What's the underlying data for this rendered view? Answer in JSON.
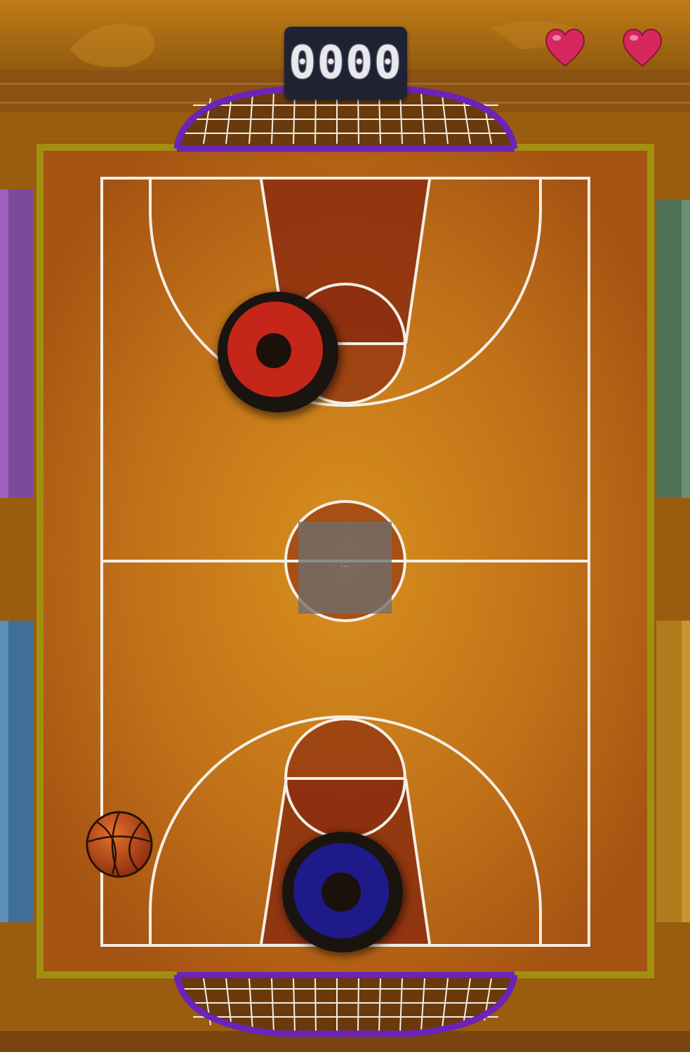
{
  "game": {
    "score": "0000",
    "lives": 2,
    "center_overlay_text": "..."
  },
  "colors": {
    "court_center": "#d58c1c",
    "court_edge": "#a85614",
    "paint": "#8c2e0f",
    "lines": "#f4efe6",
    "rail": "#9e8d14",
    "goal_rim": "#6b23b8",
    "player_top_ring": "#c42619",
    "player_bottom_ring": "#1f1a8a",
    "heart": "#d6285e"
  },
  "icons": {
    "heart": "heart-icon",
    "ball": "basketball-icon"
  }
}
